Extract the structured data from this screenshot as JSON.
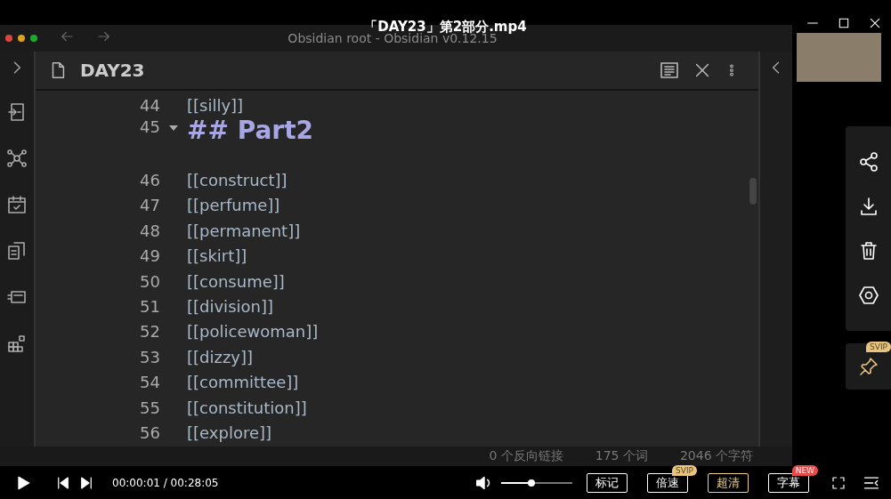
{
  "player": {
    "title": "「DAY23」第2部分.mp4"
  },
  "obsidian": {
    "window_title": "Obsidian root - Obsidian v0.12.15",
    "note_title": "DAY23",
    "lines": [
      {
        "number": "44",
        "kind": "link",
        "text": "[[silly]]"
      },
      {
        "number": "45",
        "kind": "heading",
        "text": "## Part2",
        "expanded": true
      },
      {
        "number": "46",
        "kind": "link",
        "text": "[[construct]]"
      },
      {
        "number": "47",
        "kind": "link",
        "text": "[[perfume]]"
      },
      {
        "number": "48",
        "kind": "link",
        "text": "[[permanent]]"
      },
      {
        "number": "49",
        "kind": "link",
        "text": "[[skirt]]"
      },
      {
        "number": "50",
        "kind": "link",
        "text": "[[consume]]"
      },
      {
        "number": "51",
        "kind": "link",
        "text": "[[division]]"
      },
      {
        "number": "52",
        "kind": "link",
        "text": "[[policewoman]]"
      },
      {
        "number": "53",
        "kind": "link",
        "text": "[[dizzy]]"
      },
      {
        "number": "54",
        "kind": "link",
        "text": "[[committee]]"
      },
      {
        "number": "55",
        "kind": "link",
        "text": "[[constitution]]"
      },
      {
        "number": "56",
        "kind": "link",
        "text": "[[explore]]"
      }
    ],
    "status_bar": [
      "0 个反向链接",
      "175 个词",
      "2046 个字符"
    ]
  },
  "side_actions": {
    "pin_badge": {
      "text": "SVIP",
      "color": "#e8c57f"
    }
  },
  "controls": {
    "time": "00:00:01 / 00:28:05",
    "volume": {
      "level": 0.43
    },
    "buttons": [
      {
        "label": "标记",
        "selected": false
      },
      {
        "label": "倍速",
        "selected": false,
        "badge": {
          "text": "SVIP",
          "color": "#e8c57f"
        }
      },
      {
        "label": "超清",
        "selected": true
      },
      {
        "label": "字幕",
        "selected": false,
        "badge": {
          "text": "NEW",
          "color": "#e84a4a"
        }
      }
    ]
  }
}
